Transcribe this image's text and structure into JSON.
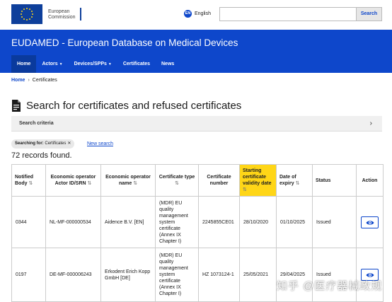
{
  "header": {
    "logo_text_line1": "European",
    "logo_text_line2": "Commission",
    "language_code": "EN",
    "language_label": "English",
    "search_placeholder": "",
    "search_button": "Search"
  },
  "banner": {
    "title": "EUDAMED - European Database on Medical Devices",
    "nav": [
      {
        "label": "Home",
        "active": true,
        "dropdown": false
      },
      {
        "label": "Actors",
        "active": false,
        "dropdown": true
      },
      {
        "label": "Devices/SPPs",
        "active": false,
        "dropdown": true
      },
      {
        "label": "Certificates",
        "active": false,
        "dropdown": false
      },
      {
        "label": "News",
        "active": false,
        "dropdown": false
      }
    ]
  },
  "breadcrumb": {
    "home": "Home",
    "current": "Certificates"
  },
  "page": {
    "title": "Search for certificates and refused certificates",
    "criteria_label": "Search criteria",
    "chip_label": "Searching for:",
    "chip_value": "Certificates",
    "new_search": "New search",
    "records": "72 records found."
  },
  "table": {
    "columns": [
      "Notified Body",
      "Economic operator Actor ID/SRN",
      "Economic operator name",
      "Certificate type",
      "Certificate number",
      "Starting certificate validity date",
      "Date of expiry",
      "Status",
      "Action"
    ],
    "rows": [
      {
        "notified_body": "0344",
        "actor_id": "NL-MF-000000534",
        "operator_name": "Aidence B.V. [EN]",
        "certificate_type": "(MDR) EU quality management system certificate (Annex IX Chapter I)",
        "certificate_number": "2245855CE01",
        "start_date": "28/10/2020",
        "expiry_date": "01/10/2025",
        "status": "Issued"
      },
      {
        "notified_body": "0197",
        "actor_id": "DE-MF-000006243",
        "operator_name": "Erkodent Erich Kopp GmbH [DE]",
        "certificate_type": "(MDR) EU quality management system certificate (Annex IX Chapter I)",
        "certificate_number": "HZ 1073124-1",
        "start_date": "25/05/2021",
        "expiry_date": "29/04/2025",
        "status": "Issued"
      }
    ]
  },
  "watermark": "知乎 @医疗器械政规",
  "colors": {
    "brand_blue": "#0e47cb",
    "highlight": "#ffd617",
    "nav_active": "#0a3a9d"
  }
}
